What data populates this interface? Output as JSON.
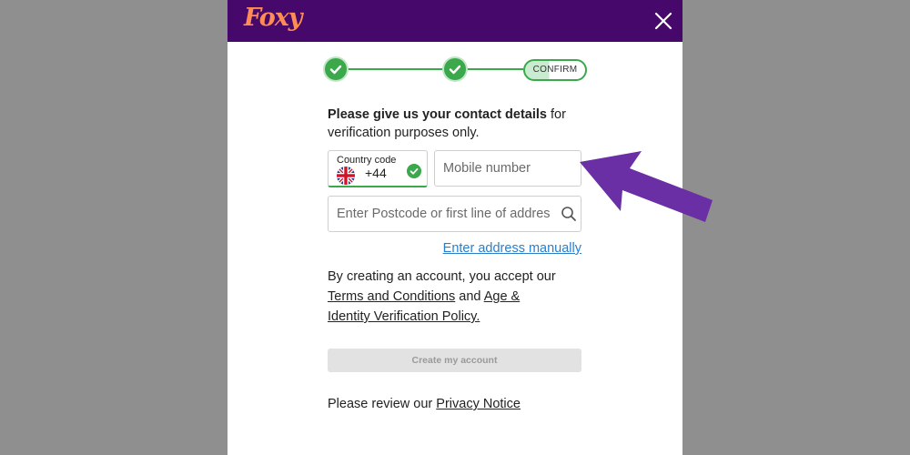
{
  "brand": {
    "logo_text": "Foxy",
    "header_color": "#46086b",
    "logo_color": "#ff8c54"
  },
  "stepper": {
    "steps": [
      "completed",
      "completed",
      "current"
    ],
    "confirm_label": "CONFIRM",
    "accent": "#3aa84b"
  },
  "intro": {
    "bold": "Please give us your contact details",
    "rest": " for verification purposes only."
  },
  "country": {
    "label": "Country code",
    "value": "+44",
    "flag": "uk-flag-icon"
  },
  "mobile": {
    "placeholder": "Mobile number"
  },
  "postcode": {
    "placeholder": "Enter Postcode or first line of address"
  },
  "manual_link": "Enter address manually",
  "terms": {
    "prefix": "By creating an account, you accept our ",
    "link1": "Terms and Conditions",
    "middle": " and ",
    "link2": "Age & Identity Verification Policy."
  },
  "create_button": "Create my account",
  "privacy": {
    "prefix": "Please review our ",
    "link": "Privacy Notice"
  },
  "annotation": {
    "arrow_color": "#6a2ea5"
  }
}
